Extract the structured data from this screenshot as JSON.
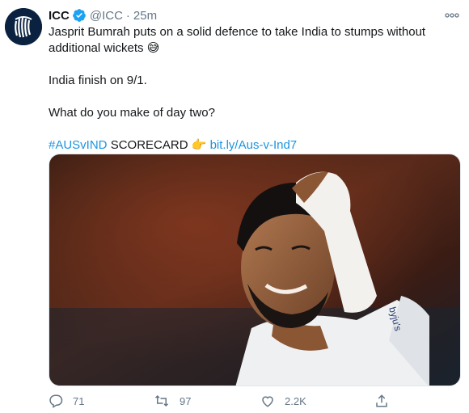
{
  "account": {
    "name": "ICC",
    "handle": "@ICC",
    "separator": "·",
    "time": "25m"
  },
  "tweet": {
    "line1": "Jasprit Bumrah puts on a solid defence to take India to stumps without additional wickets",
    "emoji1": "😅",
    "line2": "India finish on 9/1.",
    "line3": "What do you make of day two?",
    "hashtag": "#AUSvIND",
    "scorecard": "SCORECARD",
    "emoji2": "👉",
    "link": "bit.ly/Aus-v-Ind7"
  },
  "actions": {
    "replies": "71",
    "retweets": "97",
    "likes": "2.2K"
  },
  "colors": {
    "accent": "#1b95e0",
    "muted": "#657786",
    "verified": "#1da1f2"
  },
  "icons": [
    "icc-logo-icon",
    "verified-badge-icon",
    "more-options-icon",
    "reply-icon",
    "retweet-icon",
    "like-icon",
    "share-icon"
  ]
}
